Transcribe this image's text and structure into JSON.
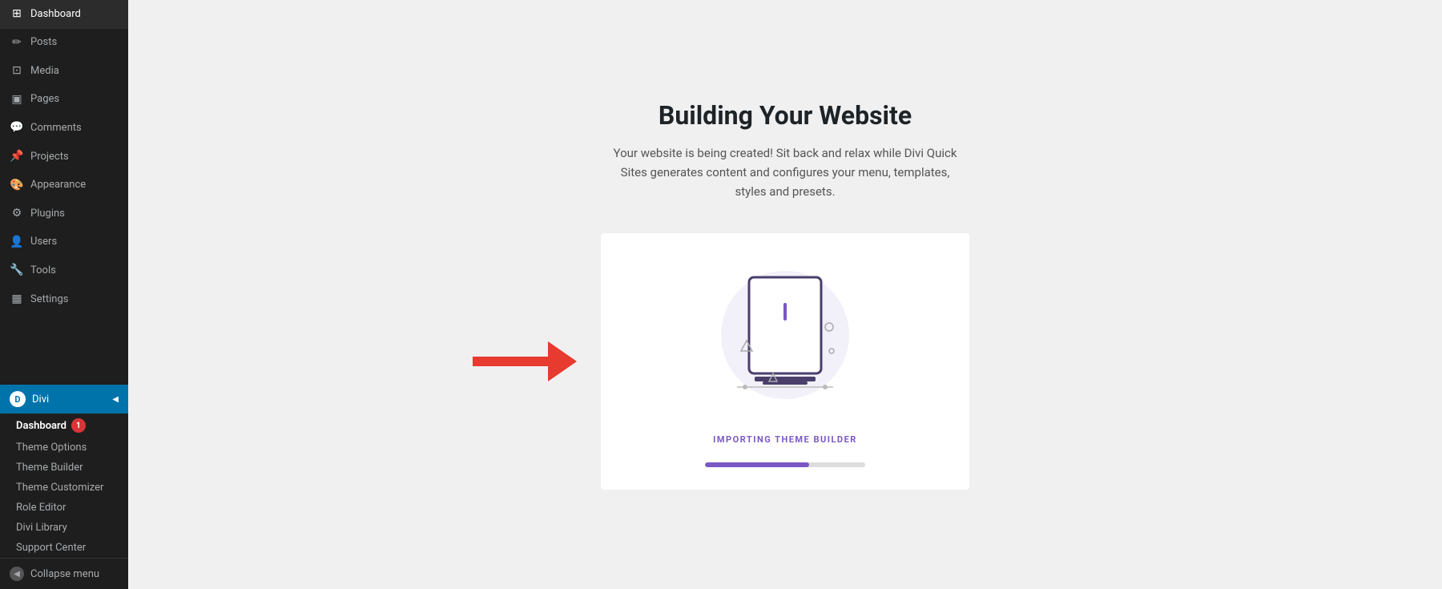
{
  "sidebar": {
    "items": [
      {
        "id": "dashboard",
        "label": "Dashboard",
        "icon": "⊞"
      },
      {
        "id": "posts",
        "label": "Posts",
        "icon": "✏"
      },
      {
        "id": "media",
        "label": "Media",
        "icon": "⊡"
      },
      {
        "id": "pages",
        "label": "Pages",
        "icon": "▣"
      },
      {
        "id": "comments",
        "label": "Comments",
        "icon": "💬"
      },
      {
        "id": "projects",
        "label": "Projects",
        "icon": "📌"
      },
      {
        "id": "appearance",
        "label": "Appearance",
        "icon": "🎨"
      },
      {
        "id": "plugins",
        "label": "Plugins",
        "icon": "⚙"
      },
      {
        "id": "users",
        "label": "Users",
        "icon": "👤"
      },
      {
        "id": "tools",
        "label": "Tools",
        "icon": "🔧"
      },
      {
        "id": "settings",
        "label": "Settings",
        "icon": "▦"
      }
    ],
    "divi_label": "Divi",
    "divi_logo": "D",
    "submenu": {
      "dashboard_label": "Dashboard",
      "notification_count": "1",
      "items": [
        {
          "id": "theme-options",
          "label": "Theme Options"
        },
        {
          "id": "theme-builder",
          "label": "Theme Builder"
        },
        {
          "id": "theme-customizer",
          "label": "Theme Customizer"
        },
        {
          "id": "role-editor",
          "label": "Role Editor"
        },
        {
          "id": "divi-library",
          "label": "Divi Library"
        },
        {
          "id": "support-center",
          "label": "Support Center"
        }
      ]
    },
    "collapse_label": "Collapse menu"
  },
  "main": {
    "title": "Building Your Website",
    "subtitle": "Your website is being created! Sit back and relax while Divi Quick Sites generates content and configures your menu, templates, styles and presets.",
    "status_label": "IMPORTING THEME BUILDER",
    "progress_percent": 65
  }
}
